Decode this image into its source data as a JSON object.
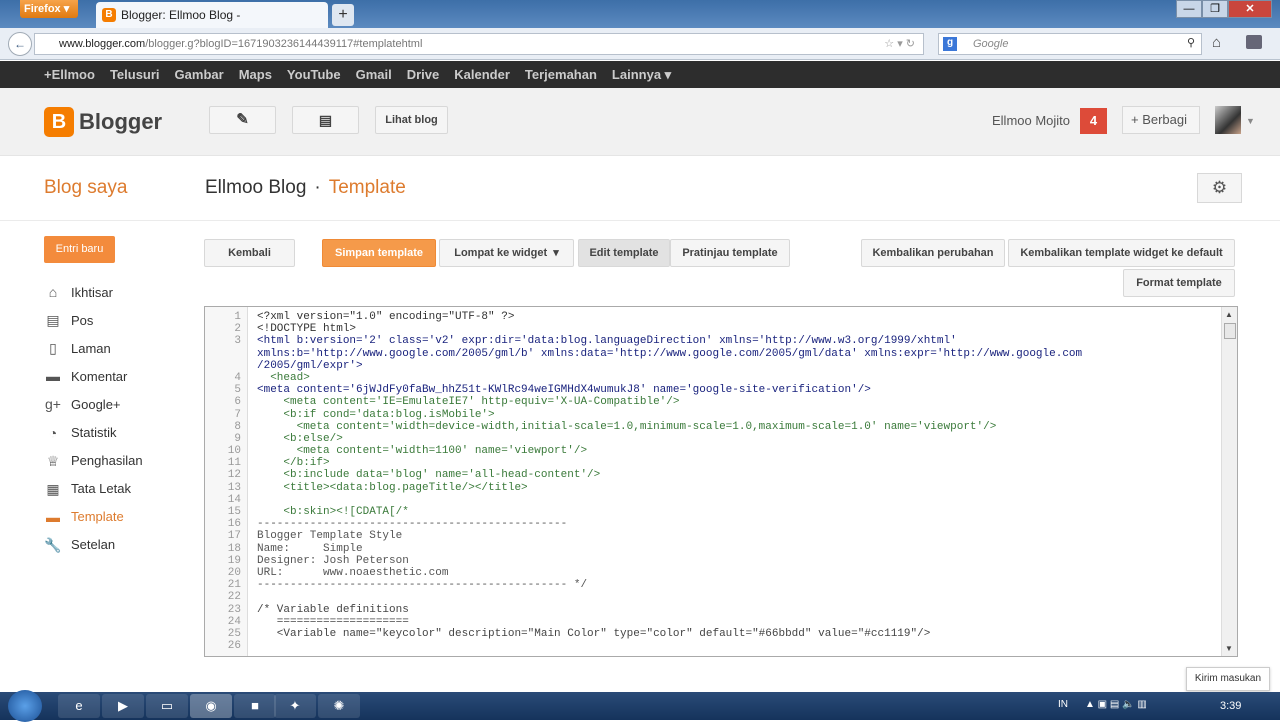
{
  "browser": {
    "menu_button": "Firefox",
    "tab_title": "Blogger: Ellmoo Blog -",
    "new_tab": "+",
    "url_host": "www.blogger.com",
    "url_path": "/blogger.g?blogID=1671903236144439117#templatehtml",
    "search_placeholder": "Google"
  },
  "google_bar": [
    "+Ellmoo",
    "Telusuri",
    "Gambar",
    "Maps",
    "YouTube",
    "Gmail",
    "Drive",
    "Kalender",
    "Terjemahan",
    "Lainnya ▾"
  ],
  "header": {
    "logo": "Blogger",
    "view_blog": "Lihat blog",
    "user_name": "Ellmoo Mojito",
    "notifications": "4",
    "share": "+ Berbagi"
  },
  "subheader": {
    "my_blogs": "Blog saya",
    "blog_name": "Ellmoo Blog",
    "separator": "·",
    "page": "Template"
  },
  "sidebar": {
    "new_post": "Entri baru",
    "items": [
      {
        "label": "Ikhtisar",
        "icon": "home-icon"
      },
      {
        "label": "Pos",
        "icon": "posts-icon"
      },
      {
        "label": "Laman",
        "icon": "page-icon"
      },
      {
        "label": "Komentar",
        "icon": "comment-icon"
      },
      {
        "label": "Google+",
        "icon": "google-plus-icon"
      },
      {
        "label": "Statistik",
        "icon": "pie-chart-icon"
      },
      {
        "label": "Penghasilan",
        "icon": "trophy-icon"
      },
      {
        "label": "Tata Letak",
        "icon": "layout-icon"
      },
      {
        "label": "Template",
        "icon": "template-icon",
        "active": true
      },
      {
        "label": "Setelan",
        "icon": "wrench-icon"
      }
    ]
  },
  "toolbar": {
    "back": "Kembali",
    "save": "Simpan template",
    "jump": "Lompat ke widget",
    "edit": "Edit template",
    "preview": "Pratinjau template",
    "revert": "Kembalikan perubahan",
    "revert_widgets": "Kembalikan template widget ke default",
    "format": "Format template"
  },
  "code_lines": [
    {
      "n": "1",
      "c": "decl",
      "t": "<?xml version=\"1.0\" encoding=\"UTF-8\" ?>"
    },
    {
      "n": "2",
      "c": "decl",
      "t": "<!DOCTYPE html>"
    },
    {
      "n": "3",
      "c": "tag",
      "t": "<html b:version='2' class='v2' expr:dir='data:blog.languageDirection' xmlns='http://www.w3.org/1999/xhtml'"
    },
    {
      "n": "",
      "c": "tag",
      "t": "xmlns:b='http://www.google.com/2005/gml/b' xmlns:data='http://www.google.com/2005/gml/data' xmlns:expr='http://www.google.com"
    },
    {
      "n": "",
      "c": "tag",
      "t": "/2005/gml/expr'>"
    },
    {
      "n": "4",
      "c": "attr",
      "t": "  <head>"
    },
    {
      "n": "5",
      "c": "tag",
      "t": "<meta content='6jWJdFy0faBw_hhZ51t-KWlRc94weIGMHdX4wumukJ8' name='google-site-verification'/>"
    },
    {
      "n": "6",
      "c": "attr",
      "t": "    <meta content='IE=EmulateIE7' http-equiv='X-UA-Compatible'/>"
    },
    {
      "n": "7",
      "c": "attr",
      "t": "    <b:if cond='data:blog.isMobile'>"
    },
    {
      "n": "8",
      "c": "attr",
      "t": "      <meta content='width=device-width,initial-scale=1.0,minimum-scale=1.0,maximum-scale=1.0' name='viewport'/>"
    },
    {
      "n": "9",
      "c": "attr",
      "t": "    <b:else/>"
    },
    {
      "n": "10",
      "c": "attr",
      "t": "      <meta content='width=1100' name='viewport'/>"
    },
    {
      "n": "11",
      "c": "attr",
      "t": "    </b:if>"
    },
    {
      "n": "12",
      "c": "attr",
      "t": "    <b:include data='blog' name='all-head-content'/>"
    },
    {
      "n": "13",
      "c": "attr",
      "t": "    <title><data:blog.pageTitle/></title>"
    },
    {
      "n": "14",
      "c": "com",
      "t": ""
    },
    {
      "n": "15",
      "c": "attr",
      "t": "    <b:skin><![CDATA[/*"
    },
    {
      "n": "16",
      "c": "com",
      "t": "-----------------------------------------------"
    },
    {
      "n": "17",
      "c": "com",
      "t": "Blogger Template Style"
    },
    {
      "n": "18",
      "c": "com",
      "t": "Name:     Simple"
    },
    {
      "n": "19",
      "c": "com",
      "t": "Designer: Josh Peterson"
    },
    {
      "n": "20",
      "c": "com",
      "t": "URL:      www.noaesthetic.com"
    },
    {
      "n": "21",
      "c": "com",
      "t": "----------------------------------------------- */"
    },
    {
      "n": "22",
      "c": "com",
      "t": ""
    },
    {
      "n": "23",
      "c": "var",
      "t": "/* Variable definitions"
    },
    {
      "n": "24",
      "c": "var",
      "t": "   ===================="
    },
    {
      "n": "25",
      "c": "var",
      "t": "   <Variable name=\"keycolor\" description=\"Main Color\" type=\"color\" default=\"#66bbdd\" value=\"#cc1119\"/>"
    },
    {
      "n": "26",
      "c": "var",
      "t": ""
    }
  ],
  "feedback": "Kirim masukan",
  "taskbar": {
    "language": "IN",
    "time": "3:39"
  },
  "colors": {
    "accent": "#dd7b2e",
    "notification": "#dd4b39",
    "button_orange": "#f59a4a"
  }
}
